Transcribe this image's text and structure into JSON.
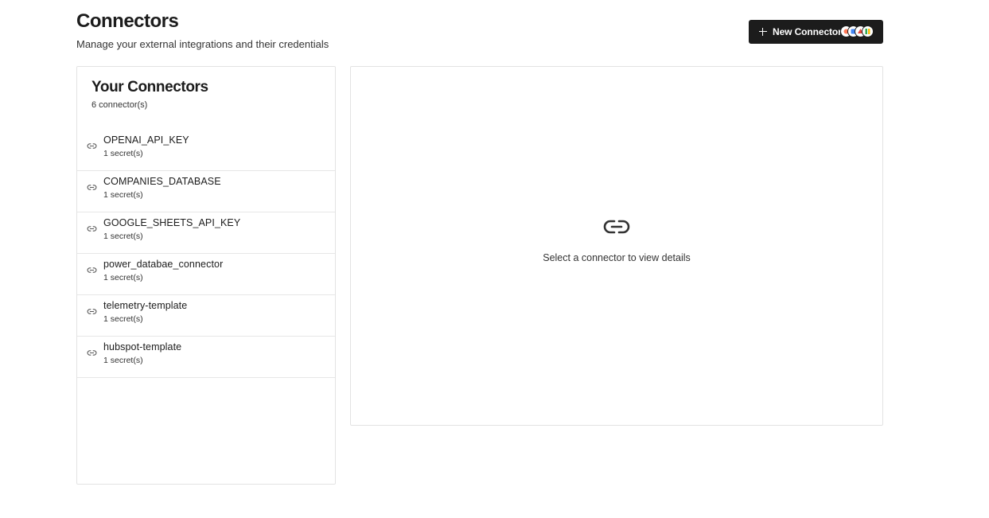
{
  "header": {
    "title": "Connectors",
    "subtitle": "Manage your external integrations and their credentials",
    "new_connector_label": "New Connector",
    "new_connector_icon": "plus-icon",
    "logo_icons": [
      "integration-logo-1",
      "integration-logo-2",
      "integration-logo-3",
      "integration-logo-4"
    ]
  },
  "connectors_panel": {
    "title": "Your Connectors",
    "count": "6 connector(s)",
    "items": [
      {
        "name": "OPENAI_API_KEY",
        "secrets": "1 secret(s)",
        "icon": "link-icon"
      },
      {
        "name": "COMPANIES_DATABASE",
        "secrets": "1 secret(s)",
        "icon": "link-icon"
      },
      {
        "name": "GOOGLE_SHEETS_API_KEY",
        "secrets": "1 secret(s)",
        "icon": "link-icon"
      },
      {
        "name": "power_databae_connector",
        "secrets": "1 secret(s)",
        "icon": "link-icon"
      },
      {
        "name": "telemetry-template",
        "secrets": "1 secret(s)",
        "icon": "link-icon"
      },
      {
        "name": "hubspot-template",
        "secrets": "1 secret(s)",
        "icon": "link-icon"
      }
    ]
  },
  "details_panel": {
    "empty_icon": "link-icon",
    "empty_message": "Select a connector to view details"
  },
  "colors": {
    "button_bg": "#1c1c1c",
    "border": "#e3e3e3",
    "text": "#1c1c1c",
    "muted_text": "#333333",
    "logo_colors": [
      "#ff7a59",
      "#4285f4",
      "#e8453c",
      "#34a853"
    ]
  }
}
